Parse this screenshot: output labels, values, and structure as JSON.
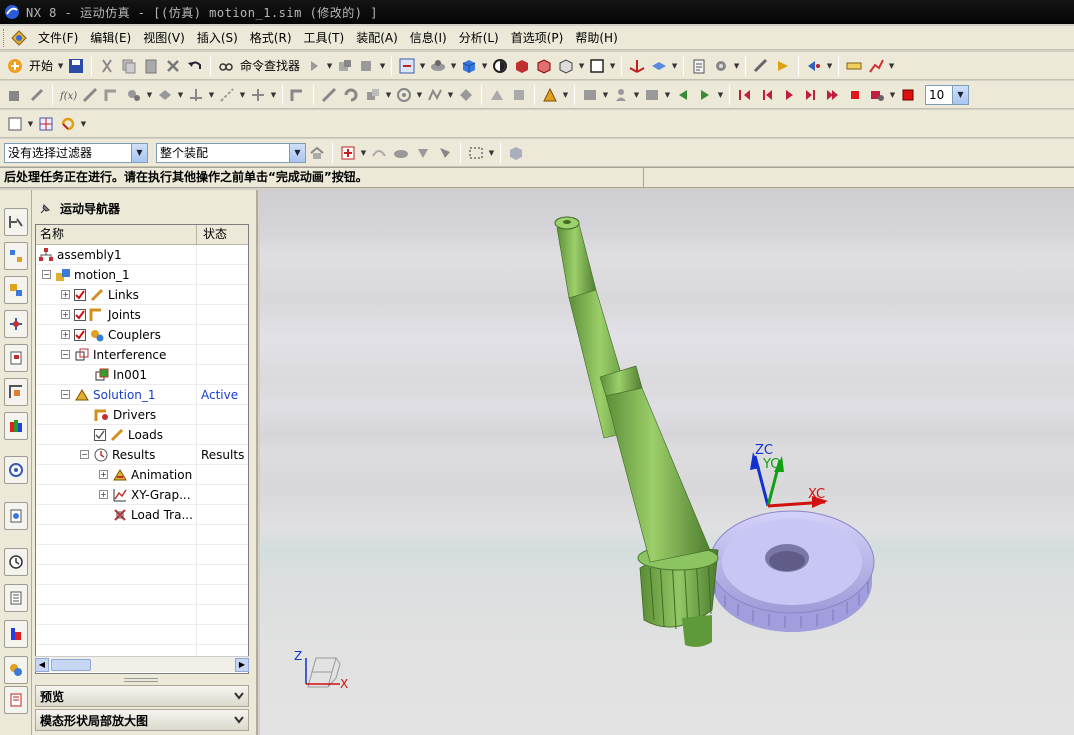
{
  "window": {
    "title": "NX 8 - 运动仿真 - [(仿真) motion_1.sim  (修改的) ]"
  },
  "menubar": {
    "items": [
      "文件(F)",
      "编辑(E)",
      "视图(V)",
      "插入(S)",
      "格式(R)",
      "工具(T)",
      "装配(A)",
      "信息(I)",
      "分析(L)",
      "首选项(P)",
      "帮助(H)"
    ]
  },
  "toolbar1": {
    "start_label": "开始",
    "command_finder_label": "命令查找器"
  },
  "toolbar2": {
    "frame_count": "10"
  },
  "selection_bar": {
    "filter_value": "没有选择过滤器",
    "scope_value": "整个装配"
  },
  "status": {
    "message": "后处理任务正在进行。请在执行其他操作之前单击“完成动画”按钮。"
  },
  "navigator": {
    "title": "运动导航器",
    "col_name": "名称",
    "col_state": "状态",
    "rows": [
      {
        "label": "assembly1",
        "state": "",
        "icon": "assembly-icon"
      },
      {
        "label": "motion_1",
        "state": "",
        "icon": "motion-icon"
      },
      {
        "label": "Links",
        "state": "",
        "icon": "links-icon"
      },
      {
        "label": "Joints",
        "state": "",
        "icon": "joints-icon"
      },
      {
        "label": "Couplers",
        "state": "",
        "icon": "couplers-icon"
      },
      {
        "label": "Interference",
        "state": "",
        "icon": "interference-icon"
      },
      {
        "label": "In001",
        "state": "",
        "icon": "interference-item-icon"
      },
      {
        "label": "Solution_1",
        "state": "Active",
        "icon": "solution-icon"
      },
      {
        "label": "Drivers",
        "state": "",
        "icon": "drivers-icon"
      },
      {
        "label": "Loads",
        "state": "",
        "icon": "loads-icon"
      },
      {
        "label": "Results",
        "state": "Results",
        "icon": "results-icon"
      },
      {
        "label": "Animation",
        "state": "",
        "icon": "animation-icon"
      },
      {
        "label": "XY-Grap...",
        "state": "",
        "icon": "xy-graph-icon"
      },
      {
        "label": "Load Tra...",
        "state": "",
        "icon": "load-transfer-icon"
      }
    ],
    "section_preview": "预览",
    "section_modal": "模态形状局部放大图"
  },
  "viewport": {
    "csys_labels": {
      "zc": "ZC",
      "yc": "YC",
      "xc": "XC"
    },
    "triad_labels": {
      "z": "Z",
      "x": "X"
    },
    "colors": {
      "shaft": "#7fb34f",
      "gear": "#b7b3ec",
      "xc_axis": "#d11010",
      "yc_axis": "#10a010",
      "zc_axis": "#1030d0"
    }
  }
}
